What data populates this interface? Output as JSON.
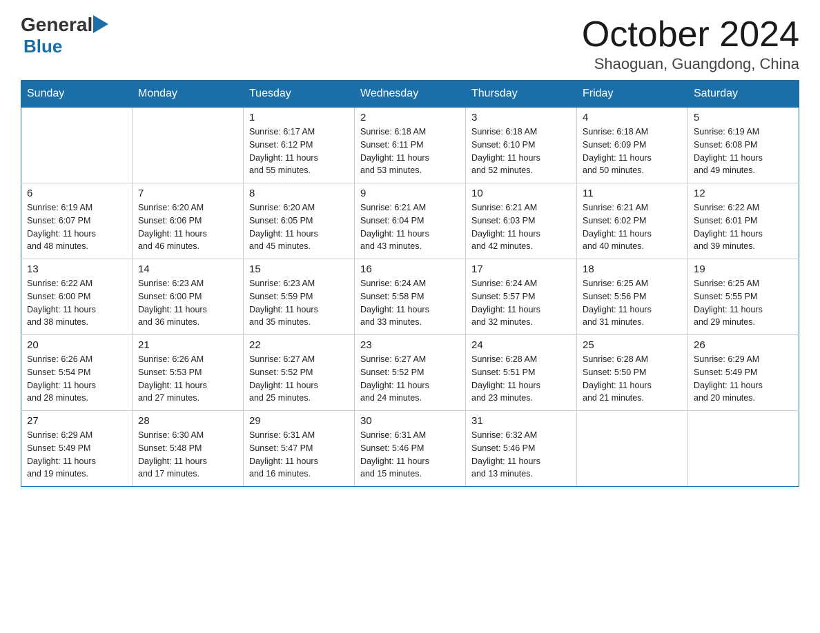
{
  "logo": {
    "general": "General",
    "blue": "Blue"
  },
  "title": "October 2024",
  "location": "Shaoguan, Guangdong, China",
  "headers": [
    "Sunday",
    "Monday",
    "Tuesday",
    "Wednesday",
    "Thursday",
    "Friday",
    "Saturday"
  ],
  "weeks": [
    [
      {
        "day": "",
        "info": ""
      },
      {
        "day": "",
        "info": ""
      },
      {
        "day": "1",
        "info": "Sunrise: 6:17 AM\nSunset: 6:12 PM\nDaylight: 11 hours\nand 55 minutes."
      },
      {
        "day": "2",
        "info": "Sunrise: 6:18 AM\nSunset: 6:11 PM\nDaylight: 11 hours\nand 53 minutes."
      },
      {
        "day": "3",
        "info": "Sunrise: 6:18 AM\nSunset: 6:10 PM\nDaylight: 11 hours\nand 52 minutes."
      },
      {
        "day": "4",
        "info": "Sunrise: 6:18 AM\nSunset: 6:09 PM\nDaylight: 11 hours\nand 50 minutes."
      },
      {
        "day": "5",
        "info": "Sunrise: 6:19 AM\nSunset: 6:08 PM\nDaylight: 11 hours\nand 49 minutes."
      }
    ],
    [
      {
        "day": "6",
        "info": "Sunrise: 6:19 AM\nSunset: 6:07 PM\nDaylight: 11 hours\nand 48 minutes."
      },
      {
        "day": "7",
        "info": "Sunrise: 6:20 AM\nSunset: 6:06 PM\nDaylight: 11 hours\nand 46 minutes."
      },
      {
        "day": "8",
        "info": "Sunrise: 6:20 AM\nSunset: 6:05 PM\nDaylight: 11 hours\nand 45 minutes."
      },
      {
        "day": "9",
        "info": "Sunrise: 6:21 AM\nSunset: 6:04 PM\nDaylight: 11 hours\nand 43 minutes."
      },
      {
        "day": "10",
        "info": "Sunrise: 6:21 AM\nSunset: 6:03 PM\nDaylight: 11 hours\nand 42 minutes."
      },
      {
        "day": "11",
        "info": "Sunrise: 6:21 AM\nSunset: 6:02 PM\nDaylight: 11 hours\nand 40 minutes."
      },
      {
        "day": "12",
        "info": "Sunrise: 6:22 AM\nSunset: 6:01 PM\nDaylight: 11 hours\nand 39 minutes."
      }
    ],
    [
      {
        "day": "13",
        "info": "Sunrise: 6:22 AM\nSunset: 6:00 PM\nDaylight: 11 hours\nand 38 minutes."
      },
      {
        "day": "14",
        "info": "Sunrise: 6:23 AM\nSunset: 6:00 PM\nDaylight: 11 hours\nand 36 minutes."
      },
      {
        "day": "15",
        "info": "Sunrise: 6:23 AM\nSunset: 5:59 PM\nDaylight: 11 hours\nand 35 minutes."
      },
      {
        "day": "16",
        "info": "Sunrise: 6:24 AM\nSunset: 5:58 PM\nDaylight: 11 hours\nand 33 minutes."
      },
      {
        "day": "17",
        "info": "Sunrise: 6:24 AM\nSunset: 5:57 PM\nDaylight: 11 hours\nand 32 minutes."
      },
      {
        "day": "18",
        "info": "Sunrise: 6:25 AM\nSunset: 5:56 PM\nDaylight: 11 hours\nand 31 minutes."
      },
      {
        "day": "19",
        "info": "Sunrise: 6:25 AM\nSunset: 5:55 PM\nDaylight: 11 hours\nand 29 minutes."
      }
    ],
    [
      {
        "day": "20",
        "info": "Sunrise: 6:26 AM\nSunset: 5:54 PM\nDaylight: 11 hours\nand 28 minutes."
      },
      {
        "day": "21",
        "info": "Sunrise: 6:26 AM\nSunset: 5:53 PM\nDaylight: 11 hours\nand 27 minutes."
      },
      {
        "day": "22",
        "info": "Sunrise: 6:27 AM\nSunset: 5:52 PM\nDaylight: 11 hours\nand 25 minutes."
      },
      {
        "day": "23",
        "info": "Sunrise: 6:27 AM\nSunset: 5:52 PM\nDaylight: 11 hours\nand 24 minutes."
      },
      {
        "day": "24",
        "info": "Sunrise: 6:28 AM\nSunset: 5:51 PM\nDaylight: 11 hours\nand 23 minutes."
      },
      {
        "day": "25",
        "info": "Sunrise: 6:28 AM\nSunset: 5:50 PM\nDaylight: 11 hours\nand 21 minutes."
      },
      {
        "day": "26",
        "info": "Sunrise: 6:29 AM\nSunset: 5:49 PM\nDaylight: 11 hours\nand 20 minutes."
      }
    ],
    [
      {
        "day": "27",
        "info": "Sunrise: 6:29 AM\nSunset: 5:49 PM\nDaylight: 11 hours\nand 19 minutes."
      },
      {
        "day": "28",
        "info": "Sunrise: 6:30 AM\nSunset: 5:48 PM\nDaylight: 11 hours\nand 17 minutes."
      },
      {
        "day": "29",
        "info": "Sunrise: 6:31 AM\nSunset: 5:47 PM\nDaylight: 11 hours\nand 16 minutes."
      },
      {
        "day": "30",
        "info": "Sunrise: 6:31 AM\nSunset: 5:46 PM\nDaylight: 11 hours\nand 15 minutes."
      },
      {
        "day": "31",
        "info": "Sunrise: 6:32 AM\nSunset: 5:46 PM\nDaylight: 11 hours\nand 13 minutes."
      },
      {
        "day": "",
        "info": ""
      },
      {
        "day": "",
        "info": ""
      }
    ]
  ]
}
